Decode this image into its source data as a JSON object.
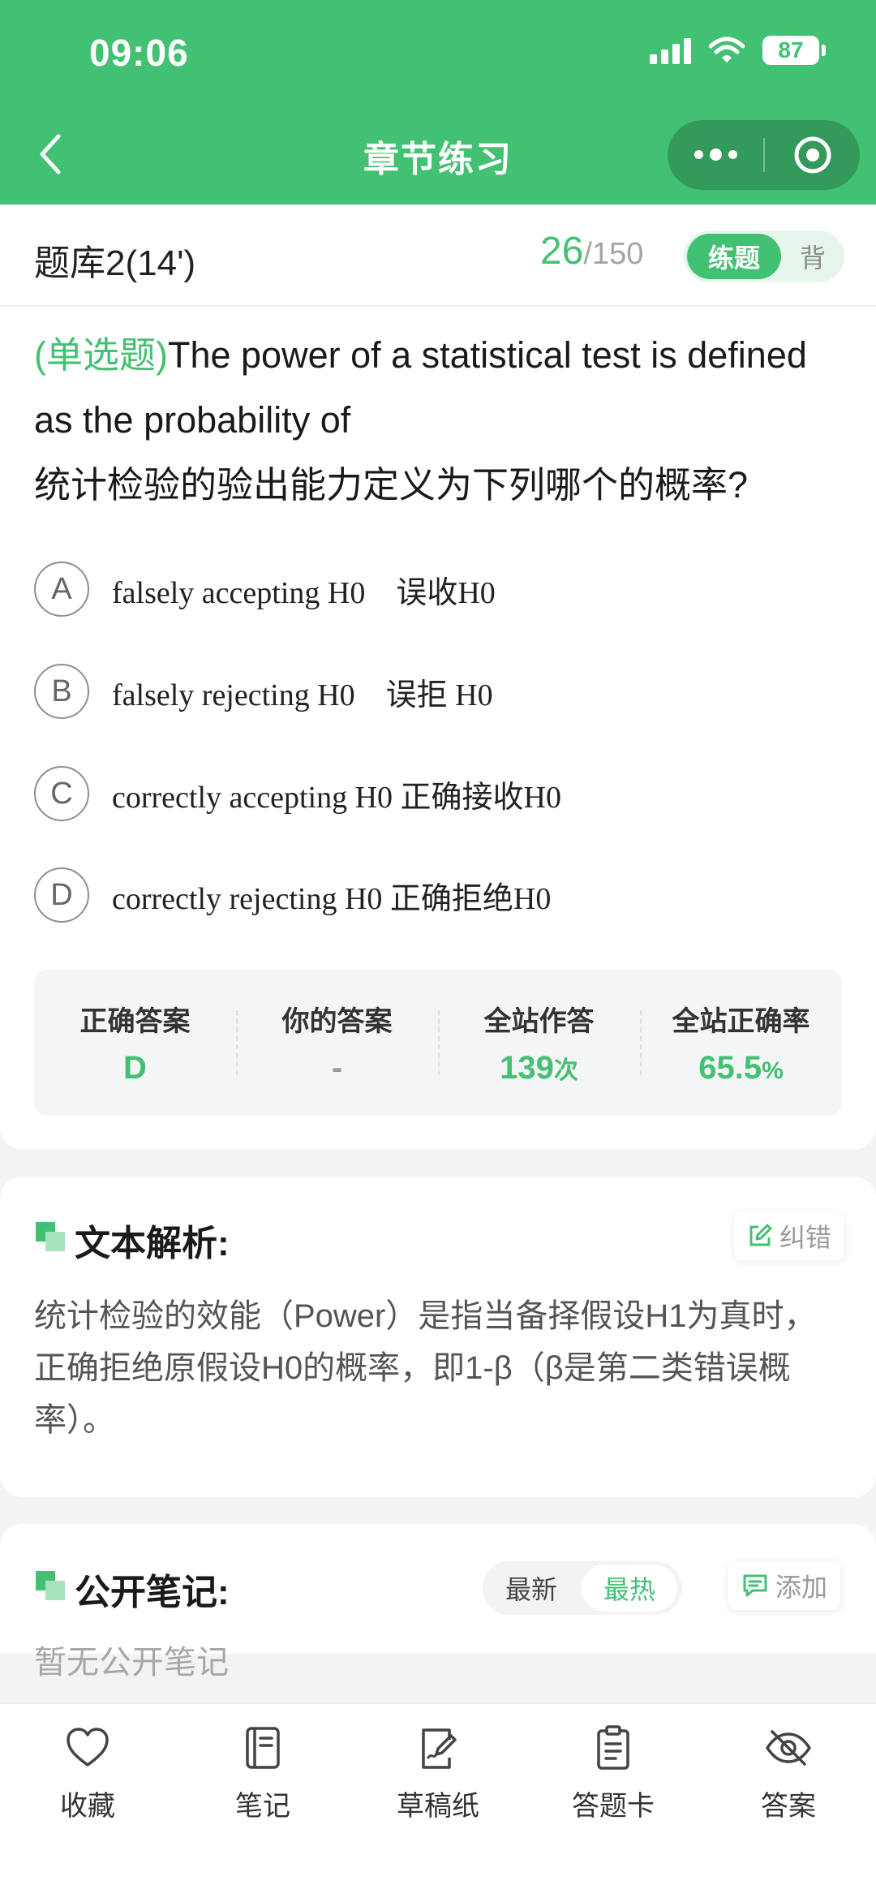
{
  "status_bar": {
    "time": "09:06",
    "battery": "87"
  },
  "nav": {
    "title": "章节练习"
  },
  "bank": {
    "name": "题库2(14')",
    "current": "26",
    "sep": "/",
    "total": "150",
    "mode_active": "练题",
    "mode_inactive": "背"
  },
  "question": {
    "type": "(单选题)",
    "text_en": "The power of a statistical test is defined as the probability of",
    "text_cn": "统计检验的验出能力定义为下列哪个的概率?",
    "options": [
      {
        "letter": "A",
        "text": "falsely accepting H0　误收H0"
      },
      {
        "letter": "B",
        "text": "falsely rejecting H0　误拒 H0"
      },
      {
        "letter": "C",
        "text": "correctly accepting H0 正确接收H0"
      },
      {
        "letter": "D",
        "text": "correctly rejecting H0 正确拒绝H0"
      }
    ]
  },
  "stats": {
    "correct_label": "正确答案",
    "correct_value": "D",
    "yours_label": "你的答案",
    "yours_value": "-",
    "site_answers_label": "全站作答",
    "site_answers_value": "139",
    "site_answers_unit": "次",
    "site_rate_label": "全站正确率",
    "site_rate_value": "65.5",
    "site_rate_unit": "%"
  },
  "analysis": {
    "title": "文本解析:",
    "correct_btn": "纠错",
    "text": "统计检验的效能（Power）是指当备择假设H1为真时，正确拒绝原假设H0的概率，即1-β（β是第二类错误概率）。"
  },
  "notes": {
    "title": "公开笔记:",
    "sort_latest": "最新",
    "sort_hot": "最热",
    "add_btn": "添加",
    "empty": "暂无公开笔记"
  },
  "bottom_nav": {
    "items": [
      {
        "label": "收藏",
        "icon": "heart-icon"
      },
      {
        "label": "笔记",
        "icon": "notebook-icon"
      },
      {
        "label": "草稿纸",
        "icon": "draft-paper-icon"
      },
      {
        "label": "答题卡",
        "icon": "answer-sheet-icon"
      },
      {
        "label": "答案",
        "icon": "eye-hidden-icon"
      }
    ]
  },
  "colors": {
    "brand": "#43c173",
    "brand_dark": "#349a5b",
    "brand_light": "#e6f6ec"
  }
}
